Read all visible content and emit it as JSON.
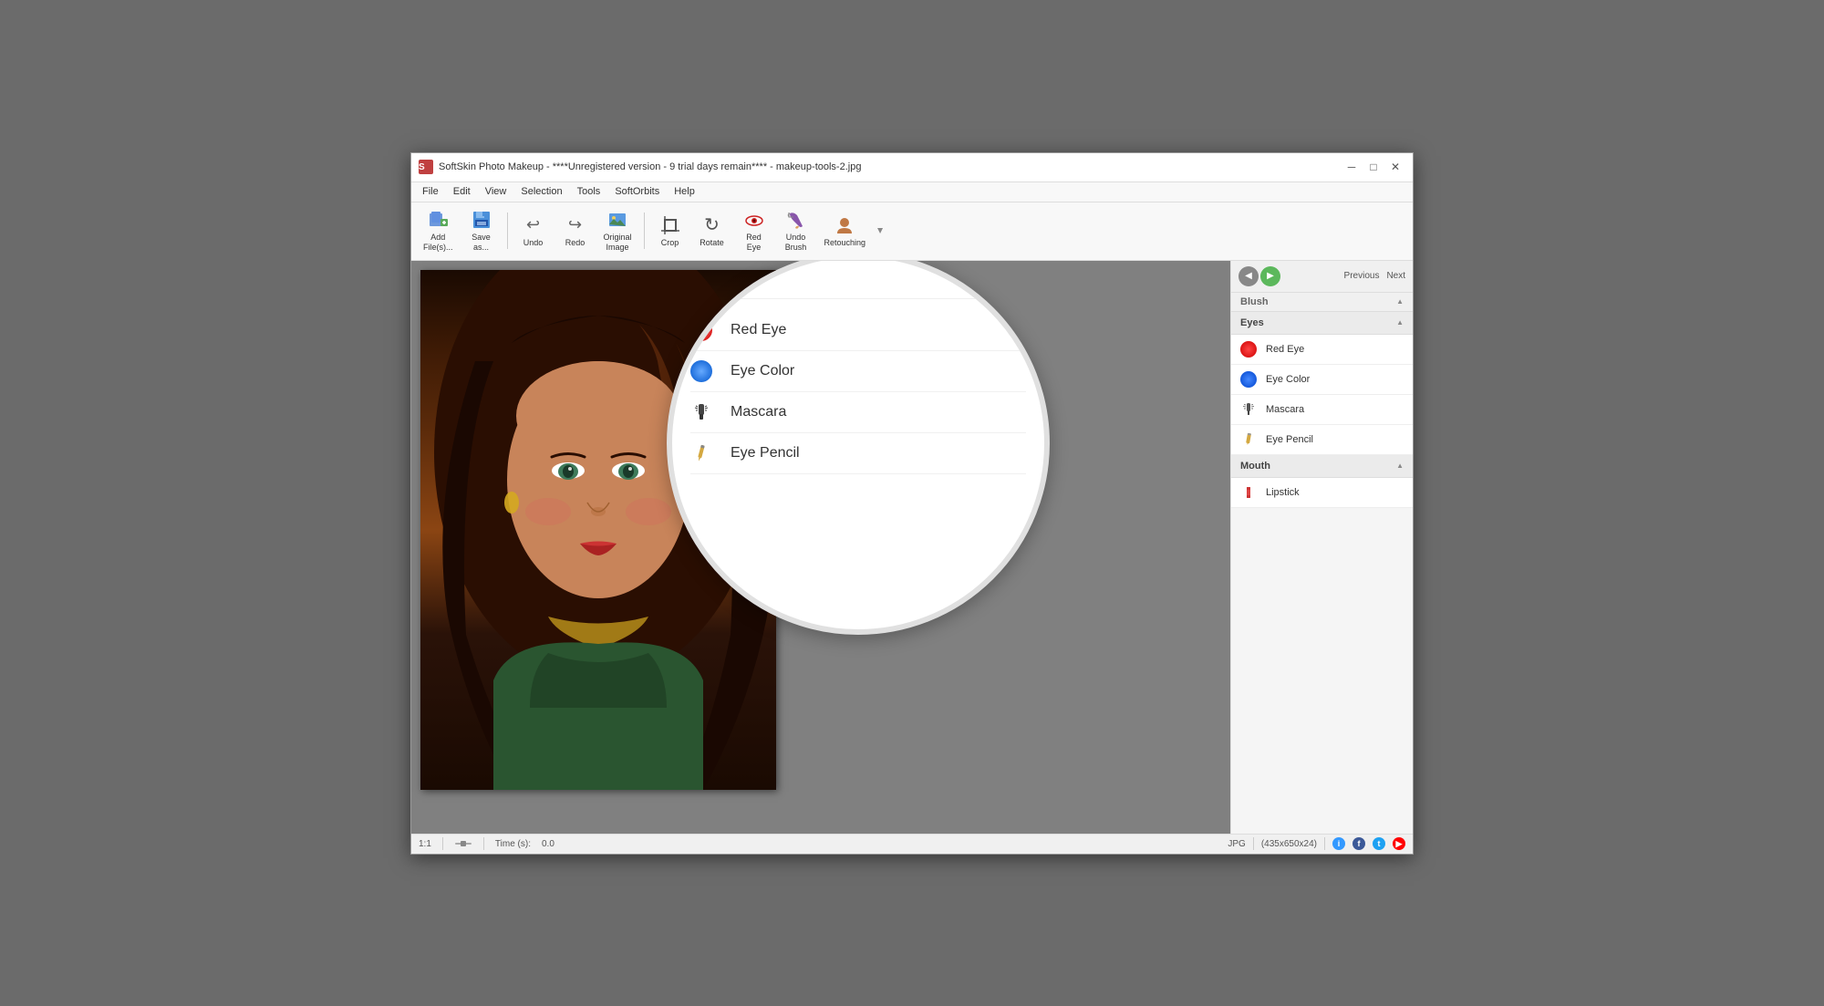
{
  "window": {
    "title": "SoftSkin Photo Makeup - ****Unregistered version - 9 trial days remain**** - makeup-tools-2.jpg",
    "icon": "🎨"
  },
  "titlebar_buttons": {
    "minimize": "─",
    "maximize": "□",
    "close": "✕"
  },
  "menubar": {
    "items": [
      "File",
      "Edit",
      "View",
      "Selection",
      "Tools",
      "SoftOrbits",
      "Help"
    ]
  },
  "toolbar": {
    "buttons": [
      {
        "id": "add-files",
        "icon": "📁",
        "label": "Add\nFile(s)..."
      },
      {
        "id": "save-as",
        "icon": "💾",
        "label": "Save\nas..."
      },
      {
        "id": "undo",
        "icon": "↩",
        "label": "Undo"
      },
      {
        "id": "redo",
        "icon": "↪",
        "label": "Redo"
      },
      {
        "id": "original-image",
        "icon": "🖼",
        "label": "Original\nImage"
      },
      {
        "id": "crop",
        "icon": "⊡",
        "label": "Crop"
      },
      {
        "id": "rotate",
        "icon": "↻",
        "label": "Rotate"
      },
      {
        "id": "red-eye",
        "icon": "👁",
        "label": "Red\nEye"
      },
      {
        "id": "undo-brush",
        "icon": "🖌",
        "label": "Undo\nBrush"
      },
      {
        "id": "retouching",
        "icon": "👤",
        "label": "Retouching"
      }
    ]
  },
  "sidebar": {
    "nav": {
      "prev_label": "Previous",
      "next_label": "Next"
    },
    "blush_section": {
      "label": "Blush"
    },
    "eyes_section": {
      "label": "Eyes"
    },
    "tools": [
      {
        "id": "red-eye",
        "icon_type": "red",
        "label": "Red Eye"
      },
      {
        "id": "eye-color",
        "icon_type": "blue",
        "label": "Eye Color"
      },
      {
        "id": "mascara",
        "icon_type": "mascara",
        "label": "Mascara"
      },
      {
        "id": "eye-pencil",
        "icon_type": "pencil-gold",
        "label": "Eye Pencil"
      }
    ],
    "mouth_section": {
      "label": "Mouth"
    },
    "mouth_tools": [
      {
        "id": "lipstick",
        "icon_type": "lipstick",
        "label": "Lipstick"
      }
    ]
  },
  "magnify": {
    "section": "Eyes",
    "items": [
      {
        "id": "red-eye",
        "icon_type": "red",
        "label": "Red Eye"
      },
      {
        "id": "eye-color",
        "icon_type": "blue",
        "label": "Eye Color"
      },
      {
        "id": "mascara",
        "icon_type": "mascara",
        "label": "Mascara"
      },
      {
        "id": "eye-pencil",
        "icon_type": "pencil-gold",
        "label": "Eye Pencil"
      }
    ]
  },
  "statusbar": {
    "zoom": "1:1",
    "time_label": "Time (s):",
    "time_value": "0.0",
    "format": "JPG",
    "dimensions": "(435x650x24)"
  }
}
